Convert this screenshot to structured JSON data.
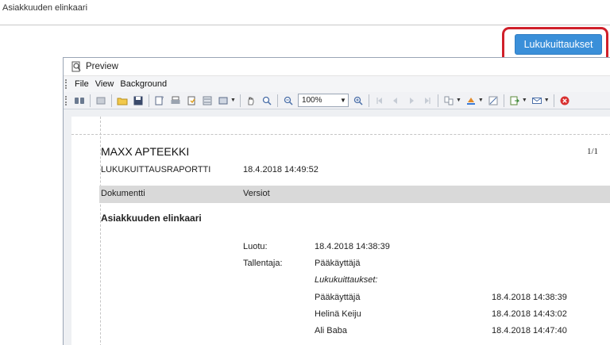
{
  "page": {
    "title": "Asiakkuuden elinkaari"
  },
  "action_button": {
    "label": "Lukukuittaukset"
  },
  "preview": {
    "window_title": "Preview",
    "menu": [
      "File",
      "View",
      "Background"
    ],
    "zoom": "100%"
  },
  "report": {
    "company": "MAXX APTEEKKI",
    "page_number": "1/1",
    "report_name": "LUKUKUITTAUSRAPORTTI",
    "report_date": "18.4.2018 14:49:52",
    "columns": [
      "Dokumentti",
      "Versiot"
    ],
    "document_name": "Asiakkuuden elinkaari",
    "created_label": "Luotu:",
    "created_value": "18.4.2018 14:38:39",
    "saver_label": "Tallentaja:",
    "saver_value": "Pääkäyttäjä",
    "receipts_label": "Lukukuittaukset:",
    "receipts": [
      {
        "name": "Pääkäyttäjä",
        "time": "18.4.2018 14:38:39"
      },
      {
        "name": "Helinä Keiju",
        "time": "18.4.2018 14:43:02"
      },
      {
        "name": "Ali Baba",
        "time": "18.4.2018 14:47:40"
      }
    ]
  },
  "colors": {
    "accent": "#3a8fd9",
    "highlight": "#d0202a",
    "header_band": "#d9d9d9"
  }
}
